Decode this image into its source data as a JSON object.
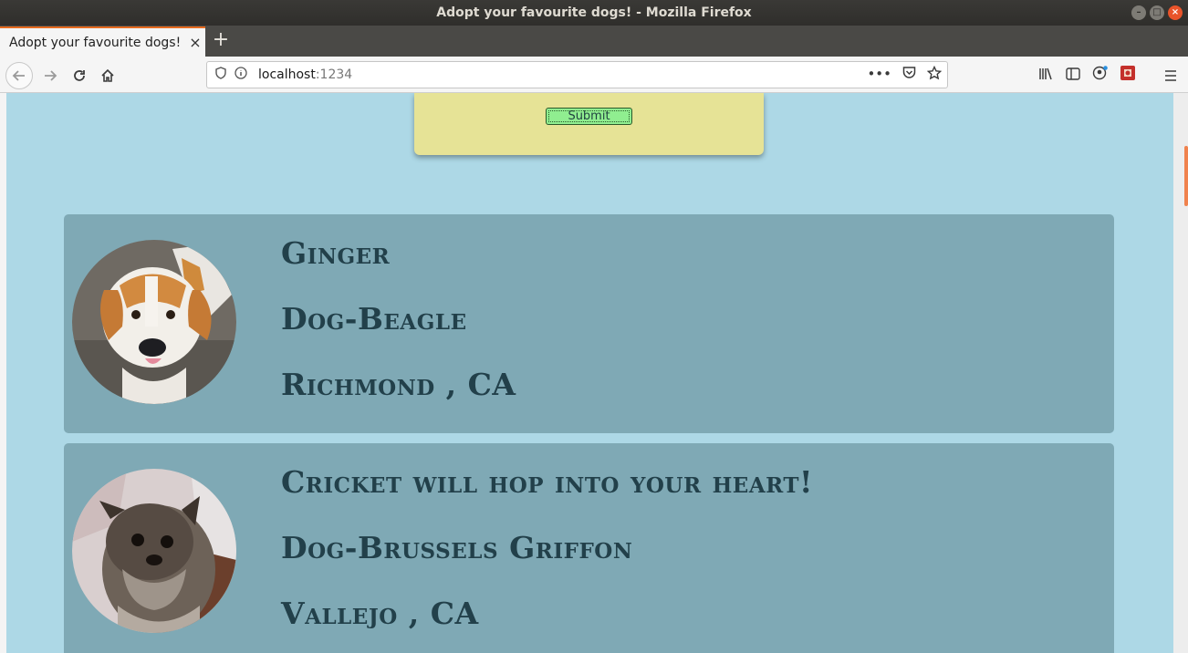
{
  "window": {
    "title": "Adopt your favourite dogs! - Mozilla Firefox"
  },
  "tab": {
    "title": "Adopt your favourite dogs!",
    "close": "×",
    "new_tab": "+"
  },
  "url": {
    "host": "localhost",
    "port": ":1234"
  },
  "form": {
    "submit_label": "Submit"
  },
  "pets": [
    {
      "name": "Ginger",
      "breed": "Dog-Beagle",
      "location": "Richmond , CA"
    },
    {
      "name": "Cricket will hop into your heart!",
      "breed": "Dog-Brussels Griffon",
      "location": "Vallejo , CA"
    }
  ],
  "colors": {
    "page_bg": "#add8e6",
    "card_bg": "#7fa9b5",
    "form_bg": "#e6e396",
    "submit_bg": "#90ee90",
    "text": "#22404a"
  }
}
